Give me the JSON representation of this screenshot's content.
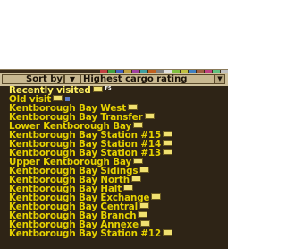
{
  "toolbar": {
    "sort_label": "Sort by",
    "direction_glyph": "▼",
    "sort_criteria": "Highest cargo rating",
    "dropdown_glyph": "▼"
  },
  "tab_colors": [
    "#c04040",
    "#40a040",
    "#4060c0",
    "#c0a040",
    "#a040a0",
    "#40a0a0",
    "#c06020",
    "#808080",
    "#e0e0e0",
    "#80c040",
    "#c0c040",
    "#4080c0",
    "#a06040",
    "#c04080",
    "#60c080",
    "#c0c0c0"
  ],
  "stations": [
    {
      "name": "Recently visited",
      "badge": "FS"
    },
    {
      "name": "Old visit",
      "badge": ""
    },
    {
      "name": "Kentborough Bay West",
      "badge": ""
    },
    {
      "name": "Kentborough Bay Transfer",
      "badge": ""
    },
    {
      "name": "Lower Kentborough Bay",
      "badge": ""
    },
    {
      "name": "Kentborough Bay Station #15",
      "badge": ""
    },
    {
      "name": "Kentborough Bay Station #14",
      "badge": ""
    },
    {
      "name": "Kentborough Bay Station #13",
      "badge": ""
    },
    {
      "name": "Upper Kentborough Bay",
      "badge": ""
    },
    {
      "name": "Kentborough Bay Sidings",
      "badge": ""
    },
    {
      "name": "Kentborough Bay North",
      "badge": ""
    },
    {
      "name": "Kentborough Bay Halt",
      "badge": ""
    },
    {
      "name": "Kentborough Bay Exchange",
      "badge": ""
    },
    {
      "name": "Kentborough Bay Central",
      "badge": ""
    },
    {
      "name": "Kentborough Bay Branch",
      "badge": ""
    },
    {
      "name": "Kentborough Bay Annexe",
      "badge": ""
    },
    {
      "name": "Kentborough Bay Station #12",
      "badge": ""
    }
  ]
}
